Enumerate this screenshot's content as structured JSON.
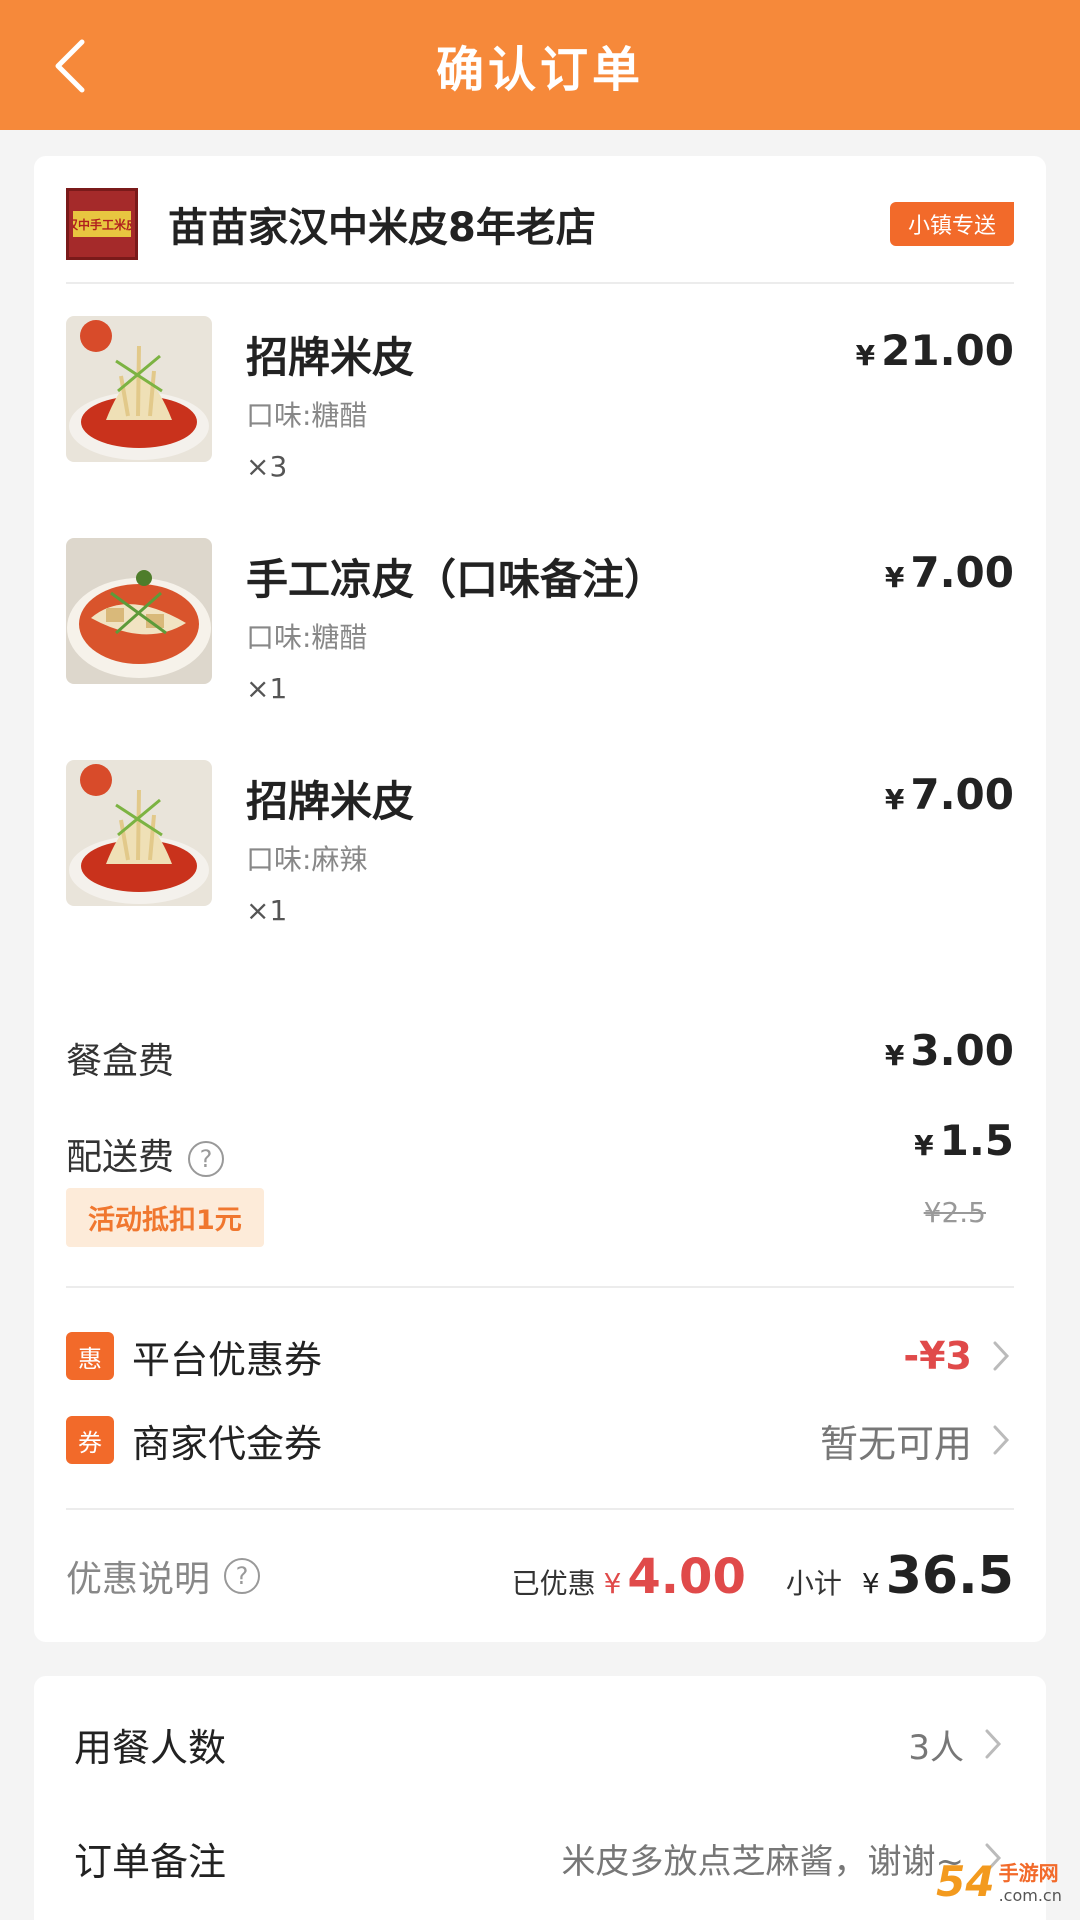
{
  "header": {
    "title": "确认订单"
  },
  "store": {
    "name": "苗苗家汉中米皮8年老店",
    "logo_text": "汉中手工米皮",
    "delivery_tag": "小镇专送"
  },
  "items": [
    {
      "name": "招牌米皮",
      "flavor": "口味:糖醋",
      "qty": "×3",
      "price": "21.00"
    },
    {
      "name": "手工凉皮（口味备注）",
      "flavor": "口味:糖醋",
      "qty": "×1",
      "price": "7.00"
    },
    {
      "name": "招牌米皮",
      "flavor": "口味:麻辣",
      "qty": "×1",
      "price": "7.00"
    }
  ],
  "currency": "¥",
  "fees": {
    "box_label": "餐盒费",
    "box_value": "3.00",
    "delivery_label": "配送费",
    "delivery_value": "1.5",
    "delivery_original": "¥2.5",
    "promo_badge": "活动抵扣1元"
  },
  "coupons": {
    "platform_icon": "惠",
    "platform_label": "平台优惠券",
    "platform_value": "-¥3",
    "merchant_icon": "券",
    "merchant_label": "商家代金券",
    "merchant_value": "暂无可用"
  },
  "summary": {
    "label": "优惠说明",
    "saved_label": "已优惠",
    "saved_amount": "4.00",
    "subtotal_label": "小计",
    "subtotal_amount": "36.5"
  },
  "extra": {
    "diners_label": "用餐人数",
    "diners_value": "3人",
    "note_label": "订单备注",
    "note_value": "米皮多放点芝麻酱，谢谢~"
  },
  "watermark": {
    "big": "54",
    "top": "手游网",
    "bottom": ".com.cn"
  },
  "colors": {
    "brand_orange": "#f6893a",
    "tag_orange": "#f26a2a",
    "discount_red": "#e04a4a"
  }
}
